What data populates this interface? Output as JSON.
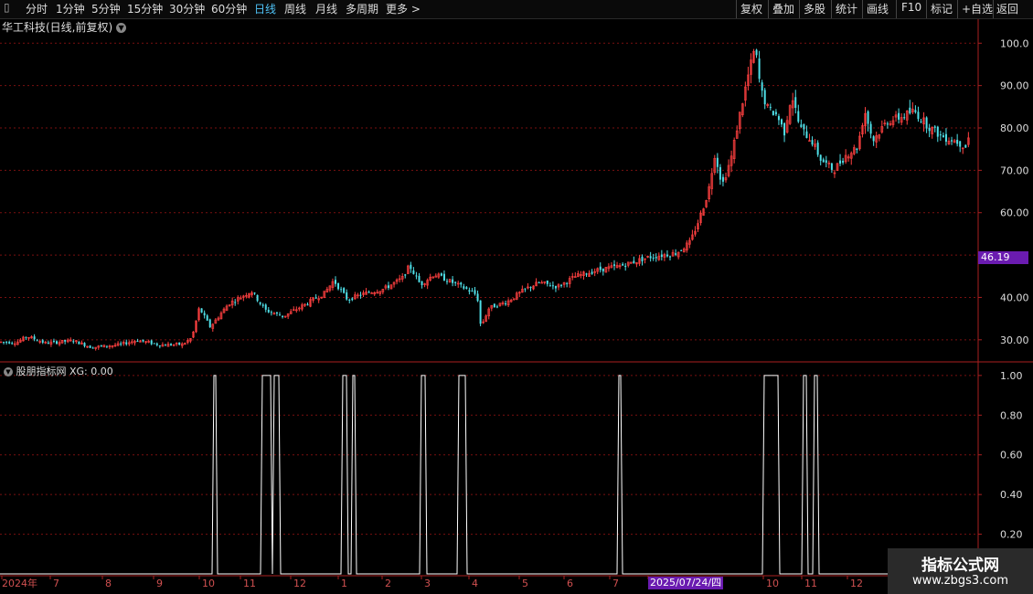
{
  "toolbar": {
    "left": [
      "分时",
      "1分钟",
      "5分钟",
      "15分钟",
      "30分钟",
      "60分钟",
      "日线",
      "周线",
      "月线",
      "多周期",
      "更多 >"
    ],
    "active": "日线",
    "right": [
      "复权",
      "叠加",
      "多股",
      "统计",
      "画线",
      "F10",
      "标记",
      "+自选",
      "返回"
    ]
  },
  "stock_title": "华工科技(日线,前复权)",
  "indicator_title": "股朋指标网 XG: 0.00",
  "price_tag": "46.19",
  "date_tag": "2025/07/24/四",
  "watermark": {
    "line1": "指标公式网",
    "line2": "www.zbgs3.com"
  },
  "colors": {
    "up": "#ff4040",
    "down": "#4fe0e8",
    "grid": "#7a1010",
    "axis": "#aa2020",
    "signal": "#ffffff"
  },
  "chart_data": [
    {
      "type": "candlestick",
      "title": "华工科技(日线,前复权)",
      "ylim": [
        25,
        102
      ],
      "y_ticks": [
        "30.00",
        "40.00",
        "50.00",
        "60.00",
        "70.00",
        "80.00",
        "90.00",
        "100.0"
      ],
      "x_ticks": [
        "2024年",
        "7",
        "8",
        "9",
        "10",
        "11",
        "12",
        "1",
        "2",
        "3",
        "4",
        "5",
        "6",
        "7",
        "2025/07/24/四",
        "10",
        "11",
        "12"
      ],
      "close_path": [
        [
          0,
          29.5
        ],
        [
          18,
          29.4
        ],
        [
          30,
          30.8
        ],
        [
          50,
          29.2
        ],
        [
          80,
          29.8
        ],
        [
          100,
          28.2
        ],
        [
          130,
          28.8
        ],
        [
          150,
          29.9
        ],
        [
          175,
          28.8
        ],
        [
          200,
          28.9
        ],
        [
          210,
          30.5
        ],
        [
          218,
          37.5
        ],
        [
          230,
          33.0
        ],
        [
          250,
          38.5
        ],
        [
          275,
          41.5
        ],
        [
          290,
          37.0
        ],
        [
          310,
          35.5
        ],
        [
          335,
          38.5
        ],
        [
          355,
          41.0
        ],
        [
          365,
          44.0
        ],
        [
          380,
          39.5
        ],
        [
          400,
          41.0
        ],
        [
          420,
          42.0
        ],
        [
          440,
          44.5
        ],
        [
          448,
          47.5
        ],
        [
          460,
          43.0
        ],
        [
          475,
          45.5
        ],
        [
          495,
          43.5
        ],
        [
          510,
          42.0
        ],
        [
          522,
          40.5
        ],
        [
          526,
          33.0
        ],
        [
          535,
          37.5
        ],
        [
          555,
          39.0
        ],
        [
          575,
          42.0
        ],
        [
          590,
          43.5
        ],
        [
          610,
          42.5
        ],
        [
          630,
          45.0
        ],
        [
          655,
          46.5
        ],
        [
          680,
          47.5
        ],
        [
          710,
          49.5
        ],
        [
          740,
          50.5
        ],
        [
          755,
          53.0
        ],
        [
          765,
          58.5
        ],
        [
          775,
          65.0
        ],
        [
          782,
          74.0
        ],
        [
          790,
          66.5
        ],
        [
          800,
          73.0
        ],
        [
          808,
          82.0
        ],
        [
          818,
          92.0
        ],
        [
          826,
          99.0
        ],
        [
          832,
          89.0
        ],
        [
          840,
          84.5
        ],
        [
          850,
          83.0
        ],
        [
          858,
          79.0
        ],
        [
          866,
          88.0
        ],
        [
          875,
          80.0
        ],
        [
          888,
          77.0
        ],
        [
          898,
          72.5
        ],
        [
          912,
          70.0
        ],
        [
          925,
          73.5
        ],
        [
          938,
          75.5
        ],
        [
          946,
          84.0
        ],
        [
          955,
          77.0
        ],
        [
          970,
          81.5
        ],
        [
          985,
          82.5
        ],
        [
          1000,
          84.0
        ],
        [
          1015,
          80.5
        ],
        [
          1030,
          78.0
        ],
        [
          1045,
          77.0
        ],
        [
          1058,
          75.5
        ],
        [
          1062,
          82.0
        ]
      ]
    },
    {
      "type": "line",
      "series_name": "XG",
      "ylim": [
        0,
        1.05
      ],
      "y_ticks": [
        "0.20",
        "0.40",
        "0.60",
        "0.80",
        "1.00"
      ],
      "signal_x_ranges": [
        [
          234,
          236
        ],
        [
          287,
          296
        ],
        [
          300,
          305
        ],
        [
          375,
          379
        ],
        [
          386,
          388
        ],
        [
          461,
          465
        ],
        [
          502,
          509
        ],
        [
          677,
          679
        ],
        [
          836,
          851
        ],
        [
          879,
          882
        ],
        [
          891,
          894
        ]
      ]
    }
  ]
}
